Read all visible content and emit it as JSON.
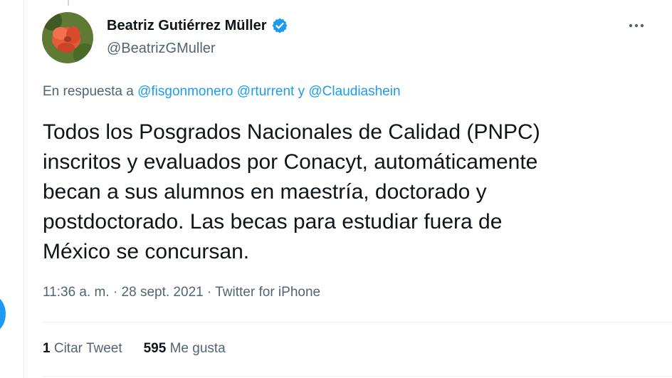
{
  "author": {
    "name": "Beatriz Gutiérrez Müller",
    "handle": "@BeatrizGMuller",
    "verified": true
  },
  "reply": {
    "prefix": "En respuesta a",
    "mention1": "@fisgonmonero",
    "mention2": "@rturrent",
    "conjunction": "y",
    "mention3": "@Claudiashein"
  },
  "tweet": {
    "lines": [
      "Todos los Posgrados Nacionales de Calidad (PNPC)",
      "inscritos y evaluados por Conacyt, automáticamente",
      "becan a sus alumnos en maestría, doctorado y",
      "postdoctorado. Las becas para estudiar fuera de",
      "México se concursan."
    ]
  },
  "meta": {
    "time": "11:36 a. m.",
    "sep1": "·",
    "date": "28 sept. 2021",
    "sep2": "·",
    "source": "Twitter for iPhone"
  },
  "stats": {
    "quotes_count": "1",
    "quotes_label": "Citar Tweet",
    "likes_count": "595",
    "likes_label": "Me gusta"
  },
  "icons": {
    "verified": "verified-badge-icon",
    "more": "more-options-icon"
  },
  "colors": {
    "accent": "#1d9bf0",
    "secondary_text": "#536471",
    "primary_text": "#0f1419"
  }
}
